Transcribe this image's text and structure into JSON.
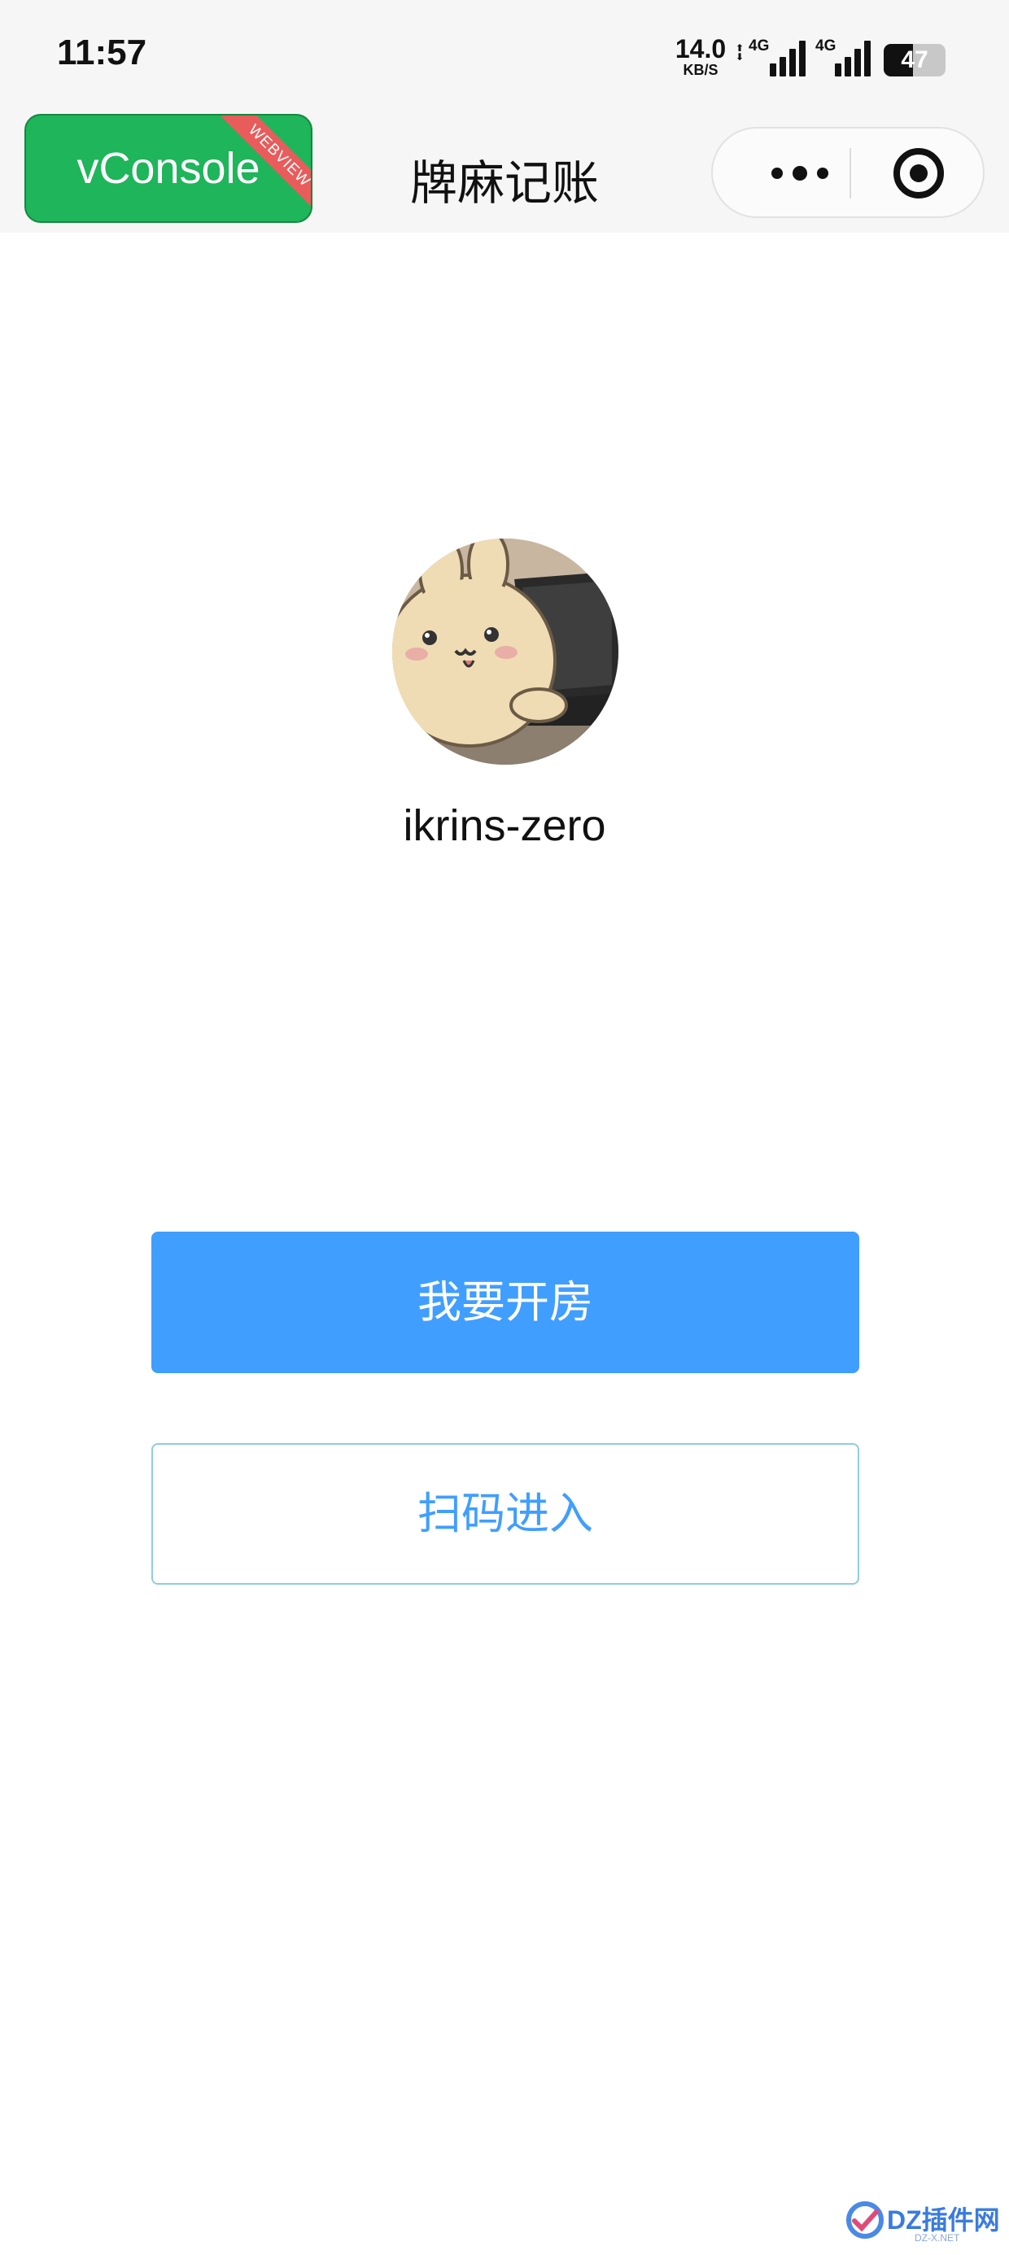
{
  "status_bar": {
    "time": "11:57",
    "net_speed_value": "14.0",
    "net_speed_unit": "KB/S",
    "signal_1_label": "4G",
    "signal_2_label": "4G",
    "battery_level": "47"
  },
  "nav": {
    "vconsole_label": "vConsole",
    "vconsole_ribbon": "WEBVIEW",
    "title": "牌麻记账"
  },
  "profile": {
    "username": "ikrins-zero"
  },
  "actions": {
    "create_room_label": "我要开房",
    "scan_join_label": "扫码进入"
  },
  "watermark": {
    "brand": "DZ插件网",
    "site": "DZ-X.NET"
  },
  "colors": {
    "primary": "#409eff",
    "vconsole_green": "#1fb55a",
    "outline_border": "#8fcde0"
  }
}
